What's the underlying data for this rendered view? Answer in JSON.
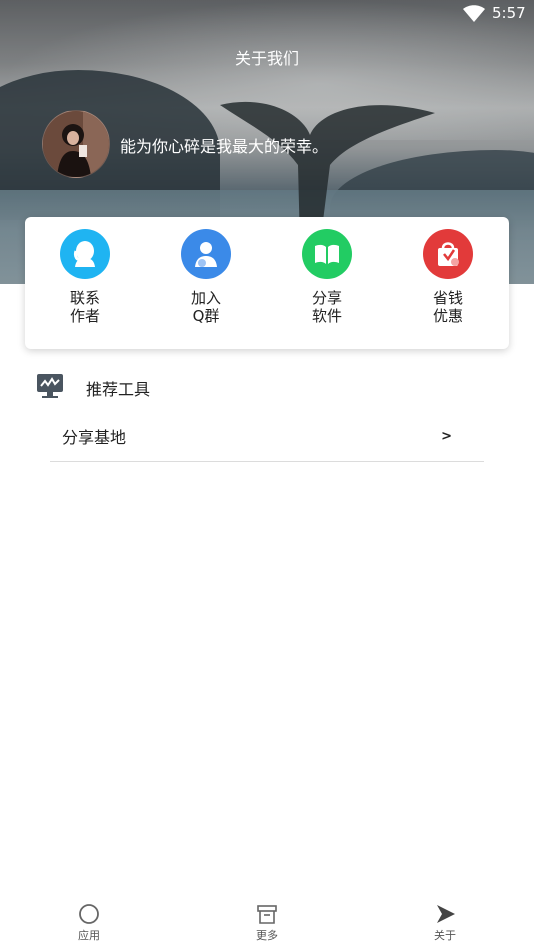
{
  "status_bar": {
    "time": "5:57",
    "wifi_icon": "wifi-icon"
  },
  "header": {
    "title": "关于我们"
  },
  "profile": {
    "motto": "能为你心碎是我最大的荣幸。"
  },
  "quick_actions": [
    {
      "line1": "联系",
      "line2": "作者",
      "icon": "contact-person-icon",
      "color": "#1fb4f2"
    },
    {
      "line1": "加入",
      "line2": "Q群",
      "icon": "group-user-icon",
      "color": "#3b8ae8"
    },
    {
      "line1": "分享",
      "line2": "软件",
      "icon": "book-share-icon",
      "color": "#22cc63"
    },
    {
      "line1": "省钱",
      "line2": "优惠",
      "icon": "shopping-bag-icon",
      "color": "#e23a3a"
    }
  ],
  "section": {
    "title": "推荐工具",
    "icon": "monitor-chart-icon"
  },
  "list": [
    {
      "label": "分享基地",
      "arrow": ">"
    }
  ],
  "bottom_nav": [
    {
      "label": "应用",
      "icon": "circle-icon"
    },
    {
      "label": "更多",
      "icon": "box-icon"
    },
    {
      "label": "关于",
      "icon": "play-arrow-icon"
    }
  ]
}
